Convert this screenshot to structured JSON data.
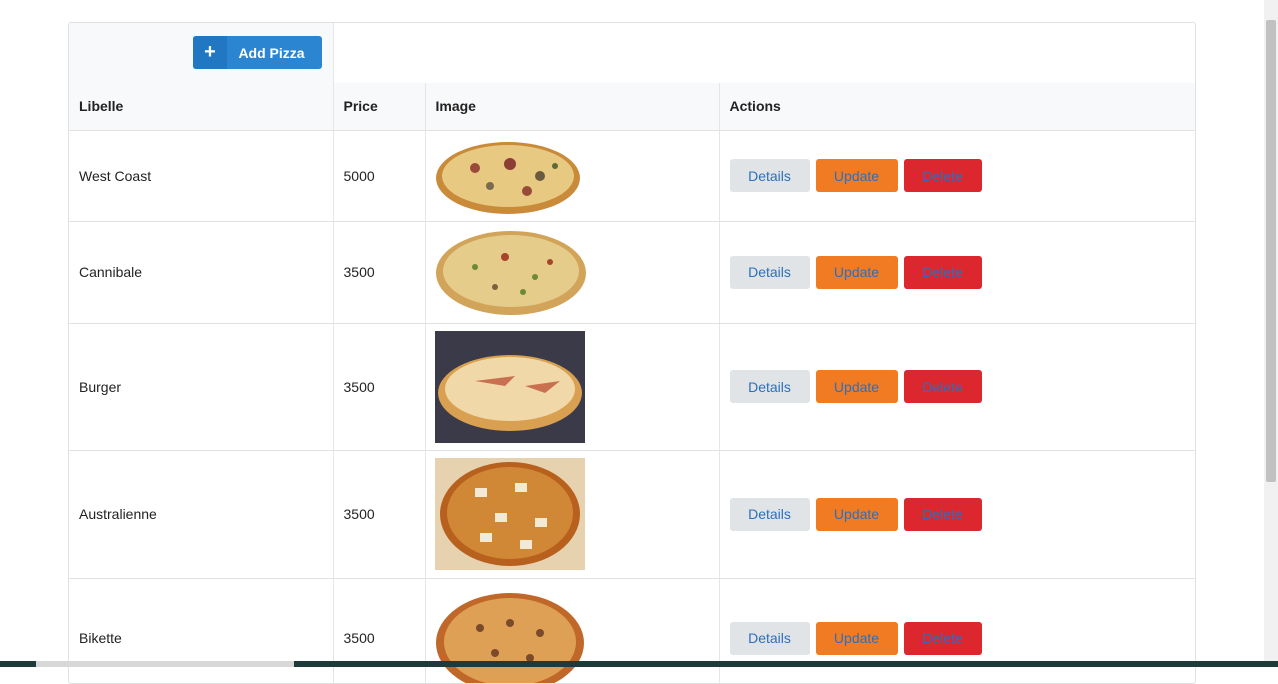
{
  "toolbar": {
    "add_label": "Add Pizza",
    "add_icon": "plus-icon"
  },
  "table": {
    "headers": {
      "libelle": "Libelle",
      "price": "Price",
      "image": "Image",
      "actions": "Actions"
    },
    "actions": {
      "details": "Details",
      "update": "Update",
      "delete": "Delete"
    },
    "rows": [
      {
        "libelle": "West Coast",
        "price": "5000"
      },
      {
        "libelle": "Cannibale",
        "price": "3500"
      },
      {
        "libelle": "Burger",
        "price": "3500"
      },
      {
        "libelle": "Australienne",
        "price": "3500"
      },
      {
        "libelle": "Bikette",
        "price": "3500"
      }
    ]
  },
  "colors": {
    "primary": "#2c85d1",
    "update": "#f07b23",
    "delete": "#dc272e",
    "details": "#e1e4e7"
  }
}
